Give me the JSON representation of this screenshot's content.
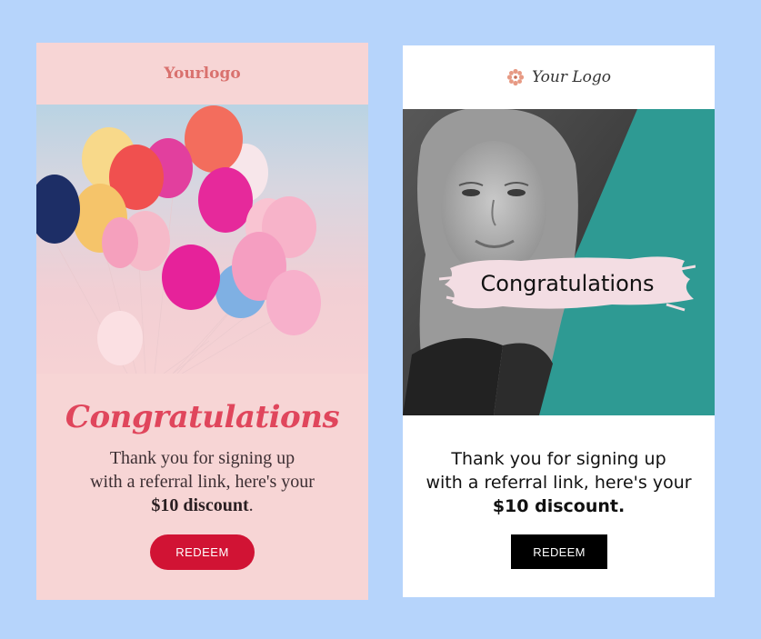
{
  "left_card": {
    "logo": "Yourlogo",
    "title": "Congratulations",
    "body_line1": "Thank you for signing up",
    "body_line2": "with a referral link, here's your",
    "discount": "$10 discount",
    "discount_suffix": ".",
    "button_label": "REDEEM",
    "accent_color": "#d11334",
    "title_color": "#e0465c",
    "background_color": "#f7d5d5"
  },
  "right_card": {
    "logo": "Your Logo",
    "logo_icon": "flower-icon",
    "title": "Congratulations",
    "body_line1": "Thank you for signing up",
    "body_line2": "with a referral link, here's your",
    "discount": "$10 discount.",
    "button_label": "REDEEM",
    "accent_color": "#2e9a93",
    "button_color": "#000000"
  },
  "page": {
    "background_color": "#b6d4fb"
  }
}
